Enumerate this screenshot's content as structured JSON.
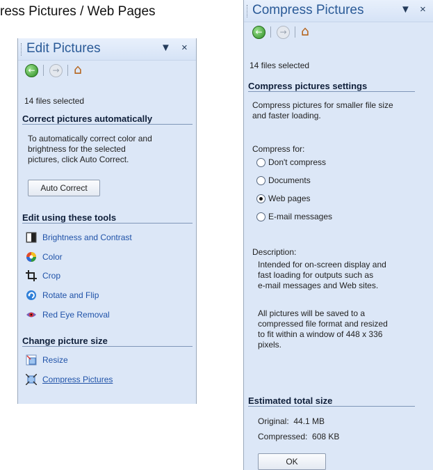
{
  "page": {
    "title": "ress Pictures / Web Pages"
  },
  "edit_pane": {
    "title": "Edit Pictures",
    "dropdown_icon": "▼",
    "close_icon": "×",
    "files_selected": "14 files selected",
    "correct_section": "Correct pictures automatically",
    "correct_desc": [
      "To automatically correct color and",
      "brightness for the selected",
      "pictures, click Auto Correct."
    ],
    "auto_correct_label": "Auto Correct",
    "tools_section": "Edit using these tools",
    "tools": [
      {
        "label": "Brightness and Contrast",
        "icon": "brightness-contrast-icon"
      },
      {
        "label": "Color",
        "icon": "color-wheel-icon"
      },
      {
        "label": "Crop",
        "icon": "crop-icon"
      },
      {
        "label": "Rotate and Flip",
        "icon": "rotate-flip-icon"
      },
      {
        "label": "Red Eye Removal",
        "icon": "red-eye-icon"
      }
    ],
    "size_section": "Change picture size",
    "size_tools": [
      {
        "label": "Resize",
        "icon": "resize-icon"
      },
      {
        "label": "Compress Pictures",
        "icon": "compress-pictures-icon"
      }
    ]
  },
  "compress_pane": {
    "title": "Compress Pictures",
    "dropdown_icon": "▼",
    "close_icon": "×",
    "files_selected": "14 files selected",
    "settings_section": "Compress pictures settings",
    "settings_desc": [
      "Compress pictures for smaller file size",
      "and faster loading."
    ],
    "compress_for_label": "Compress for:",
    "options": [
      {
        "label": "Don't compress",
        "selected": false
      },
      {
        "label": "Documents",
        "selected": false
      },
      {
        "label": "Web pages",
        "selected": true
      },
      {
        "label": "E-mail messages",
        "selected": false
      }
    ],
    "description_label": "Description:",
    "description_lines": [
      "Intended for on-screen display and",
      "fast loading for outputs such as",
      "e-mail messages and Web sites."
    ],
    "description2_lines": [
      "All pictures will be saved to a",
      "compressed file format and resized",
      "to fit within a window of 448 x 336",
      "pixels."
    ],
    "estimate_section": "Estimated total size",
    "original": "Original:  44.1 MB",
    "compressed": "Compressed:  608 KB",
    "ok_label": "OK"
  },
  "colors": {
    "pane_bg": "#dce7f7",
    "title_blue": "#2a5a97",
    "link_blue": "#1f52a8",
    "section_rule": "#7f96b8"
  }
}
